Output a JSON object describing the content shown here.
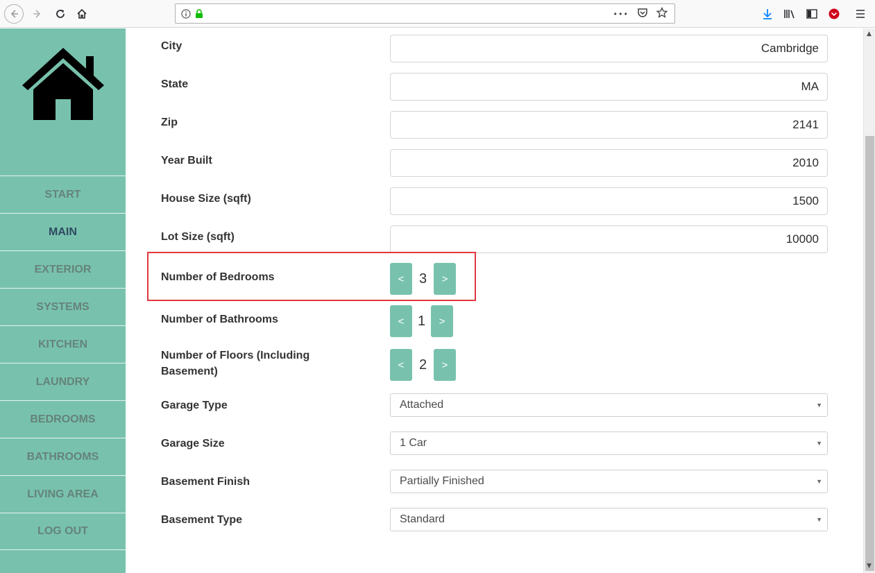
{
  "browser": {
    "url": "",
    "more_label": "•••",
    "icons": [
      "back-icon",
      "forward-icon",
      "reload-icon",
      "home-icon",
      "info-icon",
      "lock-icon",
      "pocket-icon",
      "star-icon",
      "download-icon",
      "library-icon",
      "sidebar-icon",
      "pocket-save-icon",
      "menu-icon"
    ]
  },
  "sidebar": {
    "accent": "#78c2ad",
    "items": [
      {
        "label": "START"
      },
      {
        "label": "MAIN"
      },
      {
        "label": "EXTERIOR"
      },
      {
        "label": "SYSTEMS"
      },
      {
        "label": "KITCHEN"
      },
      {
        "label": "LAUNDRY"
      },
      {
        "label": "BEDROOMS"
      },
      {
        "label": "BATHROOMS"
      },
      {
        "label": "LIVING AREA"
      },
      {
        "label": "LOG OUT"
      }
    ],
    "active": "MAIN"
  },
  "form": {
    "city": {
      "label": "City",
      "value": "Cambridge"
    },
    "state": {
      "label": "State",
      "value": "MA"
    },
    "zip": {
      "label": "Zip",
      "value": "2141"
    },
    "year_built": {
      "label": "Year Built",
      "value": "2010"
    },
    "house_size": {
      "label": "House Size (sqft)",
      "value": "1500"
    },
    "lot_size": {
      "label": "Lot Size (sqft)",
      "value": "10000"
    },
    "bedrooms": {
      "label": "Number of Bedrooms",
      "value": "3",
      "dec": "<",
      "inc": ">"
    },
    "bathrooms": {
      "label": "Number of Bathrooms",
      "value": "1",
      "dec": "<",
      "inc": ">"
    },
    "floors": {
      "label": "Number of Floors (Including Basement)",
      "value": "2",
      "dec": "<",
      "inc": ">"
    },
    "garage_type": {
      "label": "Garage Type",
      "value": "Attached"
    },
    "garage_size": {
      "label": "Garage Size",
      "value": "1 Car"
    },
    "basement_finish": {
      "label": "Basement Finish",
      "value": "Partially Finished"
    },
    "basement_type": {
      "label": "Basement Type",
      "value": "Standard"
    }
  },
  "colors": {
    "highlight": "#e0383f",
    "button": "#78c2ad"
  }
}
